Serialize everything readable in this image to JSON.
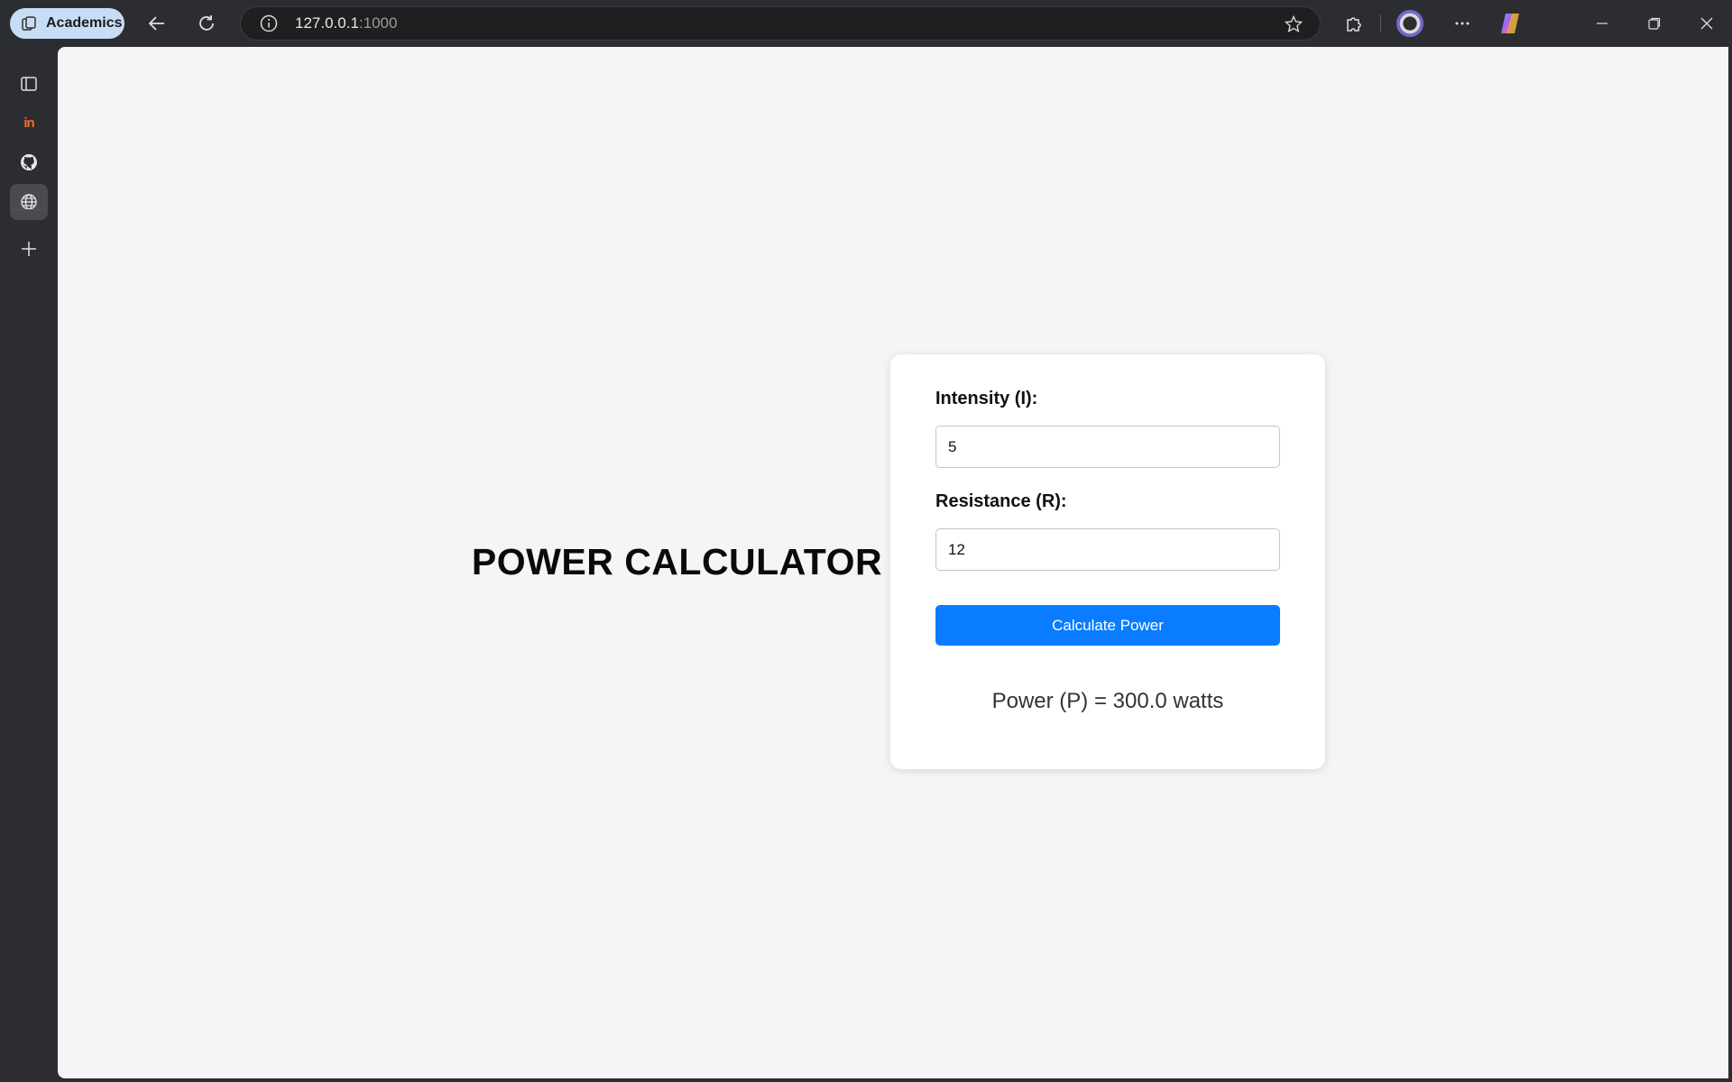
{
  "browser": {
    "profile_label": "Academics",
    "url_host": "127.0.0.1",
    "url_port": ":1000"
  },
  "sidebar": {
    "items": [
      {
        "name": "tabs-icon"
      },
      {
        "name": "invision-icon",
        "text": "in"
      },
      {
        "name": "github-icon"
      },
      {
        "name": "globe-icon"
      },
      {
        "name": "add-icon"
      }
    ]
  },
  "page": {
    "title": "POWER CALCULATOR",
    "intensity_label": "Intensity (I):",
    "intensity_value": "5",
    "resistance_label": "Resistance (R):",
    "resistance_value": "12",
    "button_label": "Calculate Power",
    "result_text": "Power (P) = 300.0 watts"
  },
  "colors": {
    "accent": "#0a7cff",
    "page_background": "#f4f5f7",
    "card_background": "#ffffff"
  }
}
